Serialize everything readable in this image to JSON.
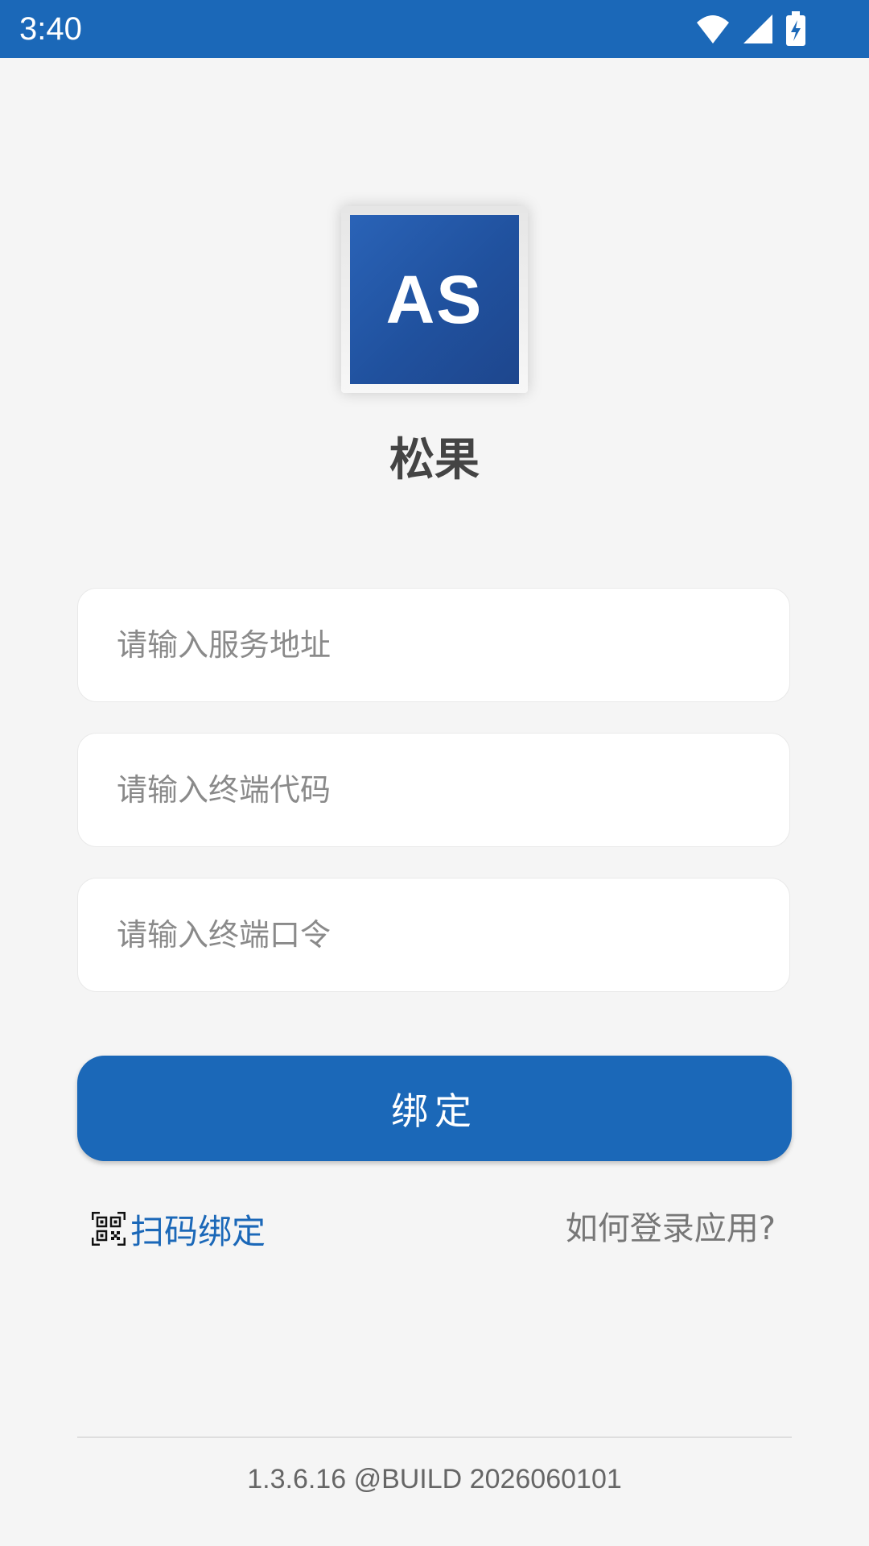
{
  "status_bar": {
    "time": "3:40",
    "icons": [
      "wifi-icon",
      "cellular-signal-icon",
      "battery-charging-icon"
    ]
  },
  "app": {
    "logo_text": "AS",
    "name": "松果"
  },
  "form": {
    "service_address_placeholder": "请输入服务地址",
    "terminal_code_placeholder": "请输入终端代码",
    "terminal_password_placeholder": "请输入终端口令",
    "bind_label": "绑定"
  },
  "links": {
    "scan_bind_label": "扫码绑定",
    "scan_icon": "qr-code-icon",
    "help_label": "如何登录应用?"
  },
  "footer": {
    "version": "1.3.6.16 @BUILD 2026060101"
  },
  "colors": {
    "primary": "#1b68b8",
    "background": "#f5f5f5",
    "logo_blue": "#20519e"
  }
}
